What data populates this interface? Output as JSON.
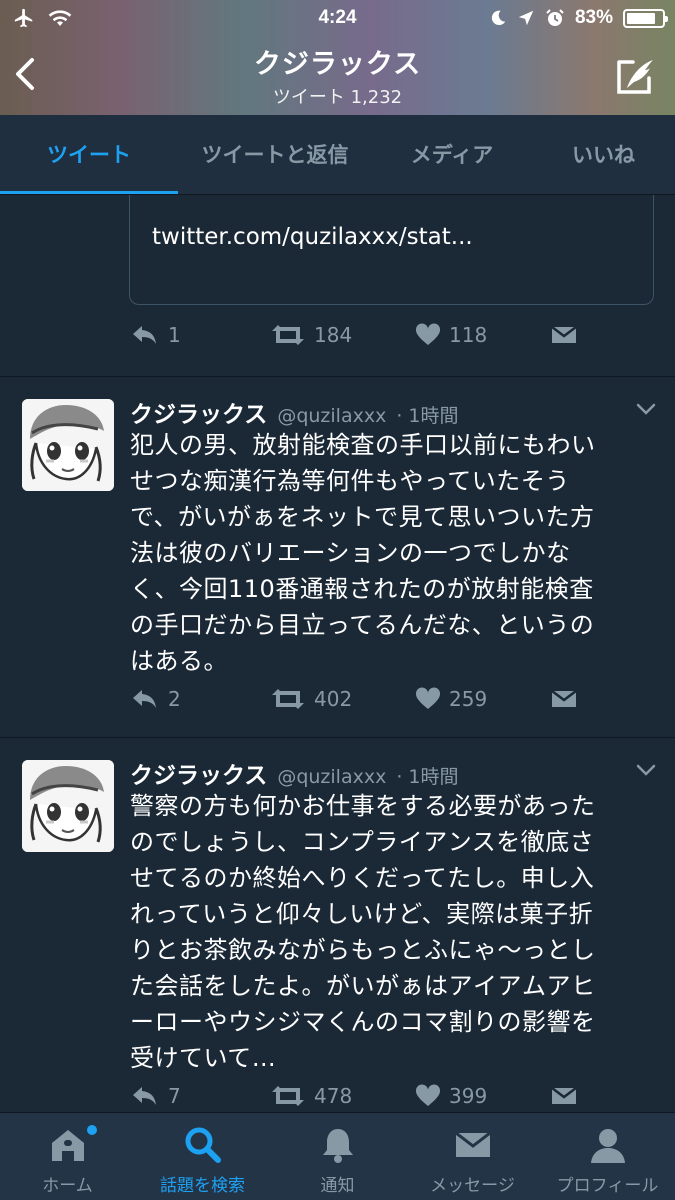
{
  "status_bar": {
    "time": "4:24",
    "battery": "83%",
    "battery_level": 0.83
  },
  "header": {
    "profile_name": "クジラックス",
    "tweet_count": "ツイート 1,232"
  },
  "tabs": [
    {
      "label": "ツイート",
      "active": true
    },
    {
      "label": "ツイートと返信",
      "active": false
    },
    {
      "label": "メディア",
      "active": false
    },
    {
      "label": "いいね",
      "active": false
    }
  ],
  "quoted": {
    "link": "twitter.com/quzilaxxx/stat..."
  },
  "first_actions": {
    "replies": "1",
    "retweets": "184",
    "likes": "118"
  },
  "tweets": [
    {
      "name": "クジラックス",
      "handle": "@quzilaxxx",
      "time": "· 1時間",
      "lines": [
        "犯人の男、放射能検査の手口以前にもわい",
        "せつな痴漢行為等何件もやっていたそう",
        "で、がいがぁをネットで見て思いついた方",
        "法は彼のバリエーションの一つでしかな",
        "く、今回110番通報されたのが放射能検査",
        "の手口だから目立ってるんだな、というの",
        "はある。"
      ],
      "replies": "2",
      "retweets": "402",
      "likes": "259"
    },
    {
      "name": "クジラックス",
      "handle": "@quzilaxxx",
      "time": "· 1時間",
      "lines": [
        "警察の方も何かお仕事をする必要があった",
        "のでしょうし、コンプライアンスを徹底さ",
        "せてるのか終始へりくだってたし。申し入",
        "れっていうと仰々しいけど、実際は菓子折",
        "りとお茶飲みながらもっとふにゃ～っとし",
        "た会話をしたよ。がいがぁはアイアムアヒ",
        "ーローやウシジマくんのコマ割りの影響を",
        "受けていて…"
      ],
      "replies": "7",
      "retweets": "478",
      "likes": "399"
    }
  ],
  "bottom_nav": [
    {
      "label": "ホーム",
      "icon": "home-icon",
      "active": false
    },
    {
      "label": "話題を検索",
      "icon": "search-icon",
      "active": true
    },
    {
      "label": "通知",
      "icon": "bell-icon",
      "active": false
    },
    {
      "label": "メッセージ",
      "icon": "envelope-icon",
      "active": false
    },
    {
      "label": "プロフィール",
      "icon": "person-icon",
      "active": false
    }
  ],
  "colors": {
    "background": "#1b2836",
    "accent": "#1da1f2",
    "muted": "#8899a6",
    "bar": "#243447"
  }
}
